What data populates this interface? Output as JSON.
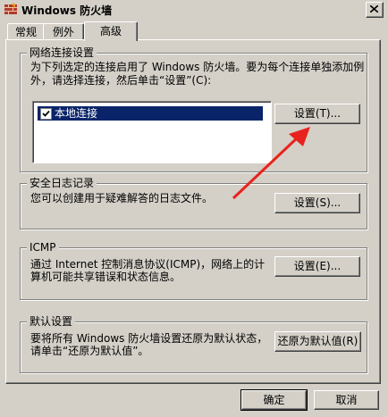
{
  "window": {
    "title": "Windows 防火墙"
  },
  "tabs": [
    {
      "label": "常规"
    },
    {
      "label": "例外"
    },
    {
      "label": "高级"
    }
  ],
  "network": {
    "group_label": "网络连接设置",
    "description_line1": "为下列选定的连接启用了 Windows 防火墙。要为每个连接单独添加例",
    "description_line2": "外，请选择连接，然后单击“设置”(C):",
    "connections": [
      {
        "label": "本地连接",
        "checked": true
      }
    ],
    "settings_button": "设置(T)..."
  },
  "security_log": {
    "group_label": "安全日志记录",
    "description": "您可以创建用于疑难解答的日志文件。",
    "settings_button": "设置(S)..."
  },
  "icmp": {
    "group_label": "ICMP",
    "description_line1": "通过 Internet 控制消息协议(ICMP)，网络上的计",
    "description_line2": "算机可能共享错误和状态信息。",
    "settings_button": "设置(E)..."
  },
  "defaults": {
    "group_label": "默认设置",
    "description_line1": "要将所有 Windows 防火墙设置还原为默认状态，",
    "description_line2": "请单击“还原为默认值”。",
    "restore_button": "还原为默认值(R)"
  },
  "footer": {
    "ok_button": "确定",
    "cancel_button": "取消"
  },
  "colors": {
    "face": "#d4d0c8",
    "selection": "#0a246a",
    "annotation_arrow": "#e8231e"
  }
}
